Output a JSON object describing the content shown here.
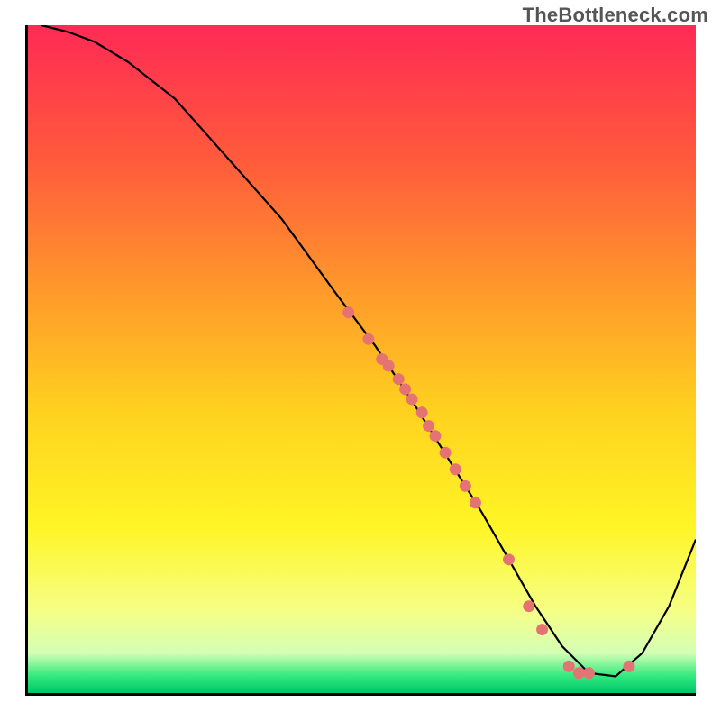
{
  "watermark": "TheBottleneck.com",
  "chart_data": {
    "type": "line",
    "title": "",
    "xlabel": "",
    "ylabel": "",
    "xlim": [
      0,
      100
    ],
    "ylim": [
      0,
      100
    ],
    "grid": false,
    "legend": false,
    "gradient_stops": [
      {
        "offset": 0.0,
        "color": "#ff2a55"
      },
      {
        "offset": 0.2,
        "color": "#ff5a3c"
      },
      {
        "offset": 0.4,
        "color": "#ff9a2a"
      },
      {
        "offset": 0.58,
        "color": "#ffd21f"
      },
      {
        "offset": 0.75,
        "color": "#fff525"
      },
      {
        "offset": 0.88,
        "color": "#f5ff88"
      },
      {
        "offset": 0.94,
        "color": "#d4ffb5"
      },
      {
        "offset": 0.975,
        "color": "#2fe97d"
      },
      {
        "offset": 1.0,
        "color": "#00c46a"
      }
    ],
    "series": [
      {
        "name": "bottleneck-curve",
        "stroke": "#000000",
        "stroke_width": 2.2,
        "x": [
          2,
          6,
          10,
          15,
          22,
          30,
          38,
          46,
          52,
          58,
          63,
          68,
          72,
          76,
          80,
          84,
          88,
          92,
          96,
          100
        ],
        "y": [
          100,
          99,
          97.5,
          94.5,
          89,
          80,
          71,
          60,
          52,
          43,
          35,
          27,
          20,
          13,
          7,
          3,
          2.5,
          6,
          13,
          23
        ]
      }
    ],
    "points": {
      "name": "markers",
      "fill": "#e57373",
      "radius": 6.5,
      "x": [
        48,
        51,
        53,
        54,
        55.5,
        56.5,
        57.5,
        59,
        60,
        61,
        62.5,
        64,
        65.5,
        67,
        72,
        75,
        77,
        81,
        82.5,
        84,
        90
      ],
      "y": [
        57,
        53,
        50,
        49,
        47,
        45.5,
        44,
        42,
        40,
        38.5,
        36,
        33.5,
        31,
        28.5,
        20,
        13,
        9.5,
        4,
        3,
        3,
        4
      ]
    }
  }
}
